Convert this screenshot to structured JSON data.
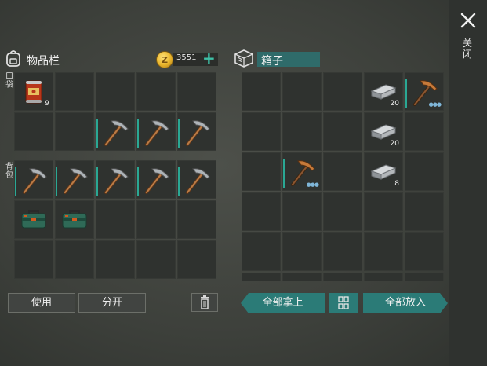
{
  "close_label": "关闭",
  "inventory": {
    "title": "物品栏",
    "coins": "3551",
    "pocket_label": "口袋",
    "backpack_label": "背包",
    "pocket_slots": [
      {
        "item": "canned-food",
        "count": "9"
      },
      {
        "item": ""
      },
      {
        "item": ""
      },
      {
        "item": ""
      },
      {
        "item": ""
      },
      {
        "item": ""
      },
      {
        "item": ""
      },
      {
        "item": "pickaxe",
        "eq": true
      },
      {
        "item": "pickaxe",
        "eq": true
      },
      {
        "item": "pickaxe",
        "eq": true
      }
    ],
    "backpack_slots": [
      {
        "item": "pickaxe",
        "eq": true
      },
      {
        "item": "pickaxe",
        "eq": true
      },
      {
        "item": "pickaxe",
        "eq": true
      },
      {
        "item": "pickaxe",
        "eq": true
      },
      {
        "item": "pickaxe",
        "eq": true
      },
      {
        "item": "toolbox"
      },
      {
        "item": "toolbox"
      },
      {
        "item": ""
      },
      {
        "item": ""
      },
      {
        "item": ""
      },
      {
        "item": ""
      },
      {
        "item": ""
      },
      {
        "item": ""
      },
      {
        "item": ""
      },
      {
        "item": ""
      }
    ],
    "use_button": "使用",
    "split_button": "分开"
  },
  "box": {
    "title": "箱子",
    "slots": [
      {
        "item": ""
      },
      {
        "item": ""
      },
      {
        "item": ""
      },
      {
        "item": "iron-ingot",
        "count": "20"
      },
      {
        "item": "copper-pickaxe",
        "eq": true,
        "dots": "●●●"
      },
      {
        "item": ""
      },
      {
        "item": ""
      },
      {
        "item": ""
      },
      {
        "item": "iron-ingot",
        "count": "20"
      },
      {
        "item": ""
      },
      {
        "item": ""
      },
      {
        "item": "copper-pickaxe",
        "eq": true,
        "dots": "●●●"
      },
      {
        "item": ""
      },
      {
        "item": "iron-ingot",
        "count": "8"
      },
      {
        "item": ""
      },
      {
        "item": ""
      },
      {
        "item": ""
      },
      {
        "item": ""
      },
      {
        "item": ""
      },
      {
        "item": ""
      },
      {
        "item": ""
      },
      {
        "item": ""
      },
      {
        "item": ""
      },
      {
        "item": ""
      },
      {
        "item": ""
      },
      {
        "item": ""
      },
      {
        "item": ""
      },
      {
        "item": ""
      },
      {
        "item": ""
      },
      {
        "item": ""
      }
    ],
    "take_all_button": "全部拿上",
    "put_all_button": "全部放入"
  },
  "colors": {
    "accent": "#2b7b77",
    "slot": "#2f322f",
    "coin": "#e8b42a"
  }
}
